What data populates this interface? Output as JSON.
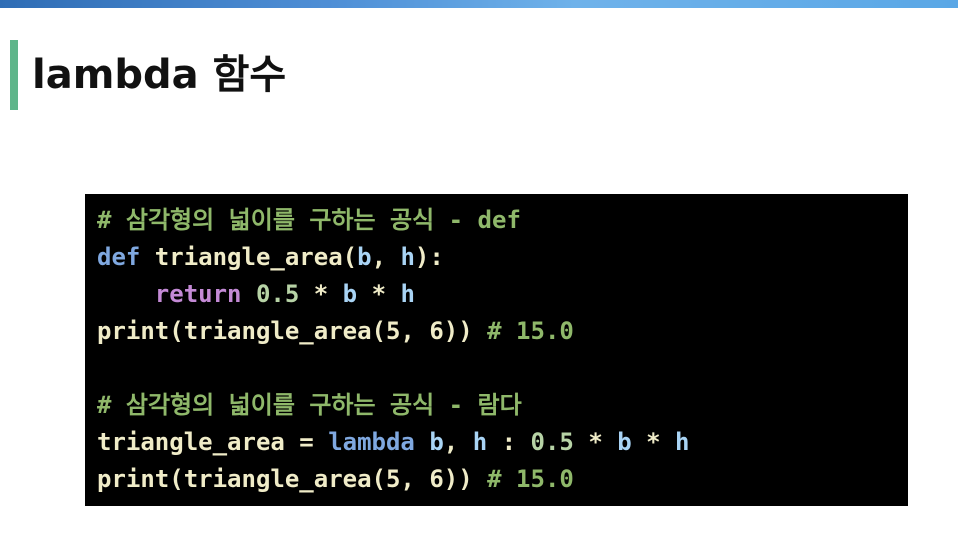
{
  "slide": {
    "title": "lambda 함수"
  },
  "code": {
    "lines": [
      [
        {
          "t": "# 삼각형의 넓이를 구하는 공식 - def",
          "k": "comment"
        }
      ],
      [
        {
          "t": "def",
          "k": "keyword"
        },
        {
          "t": " triangle_area(",
          "k": "plain"
        },
        {
          "t": "b",
          "k": "param"
        },
        {
          "t": ", ",
          "k": "plain"
        },
        {
          "t": "h",
          "k": "param"
        },
        {
          "t": "):",
          "k": "plain"
        }
      ],
      [
        {
          "t": "    ",
          "k": "plain"
        },
        {
          "t": "return",
          "k": "return"
        },
        {
          "t": " ",
          "k": "plain"
        },
        {
          "t": "0.5",
          "k": "number"
        },
        {
          "t": " * ",
          "k": "op"
        },
        {
          "t": "b",
          "k": "param"
        },
        {
          "t": " * ",
          "k": "op"
        },
        {
          "t": "h",
          "k": "param"
        }
      ],
      [
        {
          "t": "print(triangle_area(5, 6)) ",
          "k": "plain"
        },
        {
          "t": "# 15.0",
          "k": "comment"
        }
      ],
      [
        {
          "t": "",
          "k": "plain"
        }
      ],
      [
        {
          "t": "# 삼각형의 넓이를 구하는 공식 - 람다",
          "k": "comment"
        }
      ],
      [
        {
          "t": "triangle_area = ",
          "k": "plain"
        },
        {
          "t": "lambda",
          "k": "keyword"
        },
        {
          "t": " ",
          "k": "plain"
        },
        {
          "t": "b",
          "k": "param"
        },
        {
          "t": ", ",
          "k": "plain"
        },
        {
          "t": "h",
          "k": "param"
        },
        {
          "t": " : ",
          "k": "plain"
        },
        {
          "t": "0.5",
          "k": "number"
        },
        {
          "t": " * ",
          "k": "op"
        },
        {
          "t": "b",
          "k": "param"
        },
        {
          "t": " * ",
          "k": "op"
        },
        {
          "t": "h",
          "k": "param"
        }
      ],
      [
        {
          "t": "print(triangle_area(5, 6)) ",
          "k": "plain"
        },
        {
          "t": "# 15.0",
          "k": "comment"
        }
      ]
    ]
  }
}
